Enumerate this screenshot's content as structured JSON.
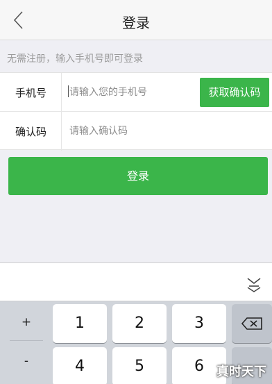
{
  "header": {
    "title": "登录",
    "back_icon": "chevron-left-icon"
  },
  "hint": "无需注册，输入手机号即可登录",
  "form": {
    "phone": {
      "label": "手机号",
      "placeholder": "请输入您的手机号",
      "get_code_label": "获取确认码"
    },
    "code": {
      "label": "确认码",
      "placeholder": "请输入确认码"
    }
  },
  "login_button": "登录",
  "keyboard": {
    "hide_icon": "keyboard-hide-icon",
    "symbols": [
      "+",
      "-"
    ],
    "keys_row1": [
      "1",
      "2",
      "3"
    ],
    "keys_row2": [
      "4",
      "5",
      "6"
    ],
    "delete_icon": "backspace-icon"
  },
  "watermark": "真时天下",
  "colors": {
    "accent": "#3bb54a"
  }
}
